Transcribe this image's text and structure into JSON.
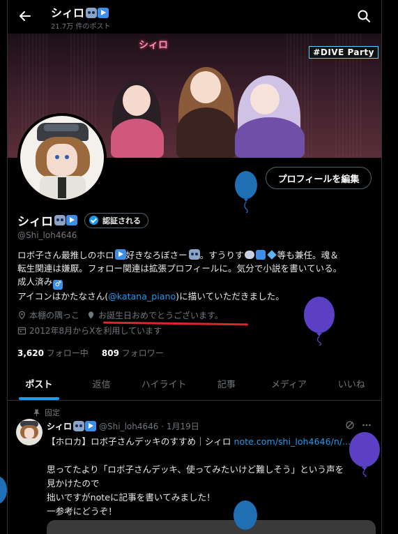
{
  "header": {
    "name": "シィロ",
    "post_count": "21.7万 件のポスト"
  },
  "banner": {
    "logo_text": "シィロ",
    "tag": "#DIVE Party"
  },
  "profile": {
    "edit_button": "プロフィールを編集",
    "name": "シィロ",
    "verify_button": "認証される",
    "handle": "@Shi_loh4646",
    "bio": {
      "line1_a": "ロボ子さん最推しのホロ",
      "line1_b": "好きなろぼさー",
      "line1_c": "。すうりす",
      "line1_d": "等も兼任。魂＆",
      "line2": "転生関連は嫌厭。フォロー関連は拡張プロフィールに。気分で小説を書いている。",
      "line3": "成人済み",
      "line4_a": "アイコンはかたなさん(",
      "line4_mention": "@katana_piano",
      "line4_b": ")に描いていただきました。"
    },
    "location": "本棚の隅っこ",
    "birthday": "お誕生日おめでとうございます。",
    "joined": "2012年8月からXを利用しています",
    "following_count": "3,620",
    "following_label": "フォロー中",
    "followers_count": "809",
    "followers_label": "フォロワー"
  },
  "tabs": [
    "ポスト",
    "返信",
    "ハイライト",
    "記事",
    "メディア",
    "いいね"
  ],
  "active_tab": "ポスト",
  "tweet": {
    "pinned_label": "固定",
    "name": "シィロ",
    "meta": "@Shi_loh4646 · 1月19日",
    "line1_a": "【ホロカ】ロボ子さんデッキのすすめ｜シィロ ",
    "line1_link": "note.com/shi_loh4646/n/...",
    "line2": "思ってたより「ロボ子さんデッキ、使ってみたいけど難しそう」という声を",
    "line3": "見かけたので",
    "line4": "拙いですがnoteに記事を書いてみました！",
    "line5": "一参考にどうぞ！"
  },
  "colors": {
    "accent": "#1d9bf0",
    "underline": "#e0242c",
    "balloon_blue": "#1f6fb5",
    "balloon_purple": "#5b3fc4"
  }
}
